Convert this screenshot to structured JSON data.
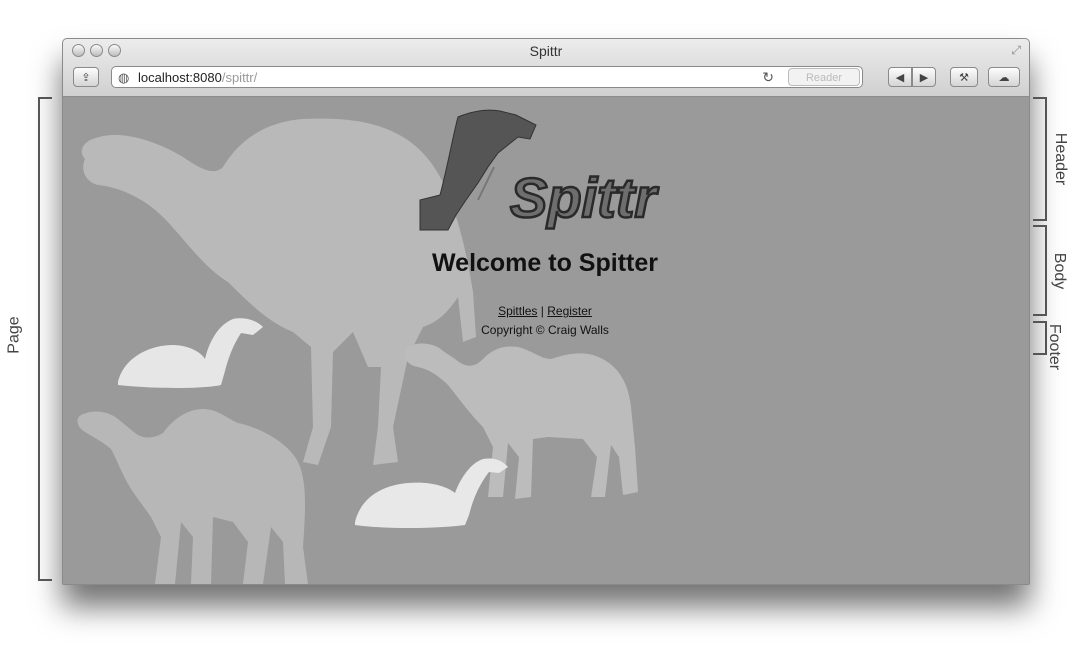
{
  "window": {
    "title": "Spittr",
    "url_host": "localhost:8080",
    "url_path": "/spittr/",
    "reader_label": "Reader"
  },
  "page": {
    "logo_text": "Spittr",
    "heading": "Welcome to Spitter",
    "nav": {
      "spittles": "Spittles",
      "separator": "|",
      "register": "Register"
    },
    "copyright": "Copyright © Craig Walls"
  },
  "annotations": {
    "page": "Page",
    "header": "Header",
    "body": "Body",
    "footer": "Footer"
  },
  "icons": {
    "share": "share-icon",
    "globe": "globe-icon",
    "reload": "reload-icon",
    "back": "back-icon",
    "forward": "forward-icon",
    "tools": "tools-icon",
    "icloud": "icloud-icon"
  }
}
